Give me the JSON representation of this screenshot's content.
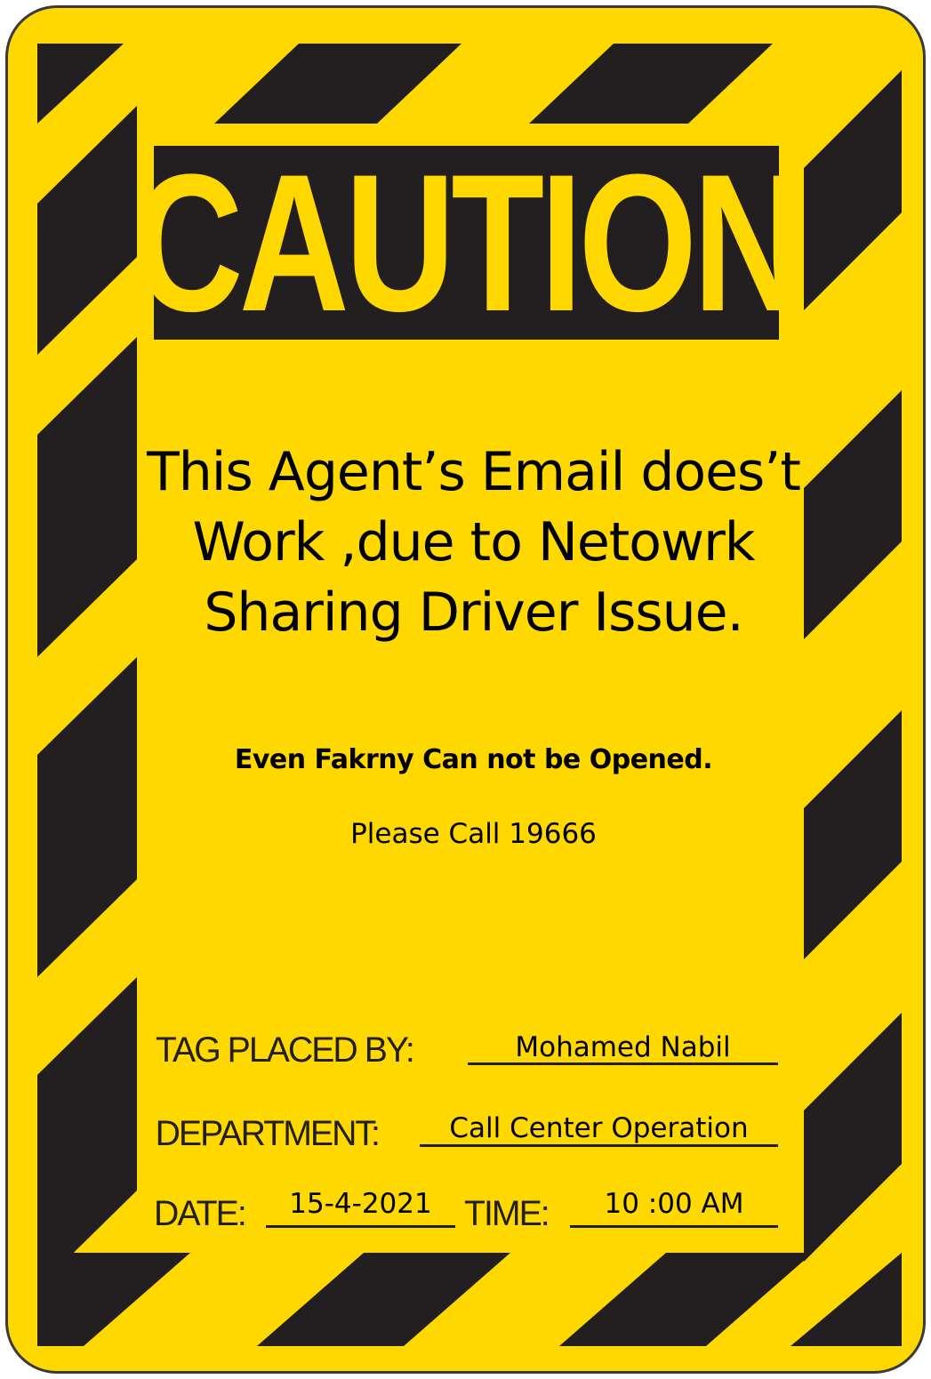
{
  "sign": {
    "heading": "CAUTION",
    "message": "This Agent’s Email does’t Work ,due to Netowrk Sharing Driver Issue.",
    "note": "Even Fakrny Can not be Opened.",
    "call": "Please Call 19666"
  },
  "fields": {
    "placed_by_label": "TAG PLACED BY:",
    "placed_by_value": "Mohamed Nabil",
    "department_label": "DEPARTMENT:",
    "department_value": "Call Center Operation",
    "date_label": "DATE:",
    "date_value": "15-4-2021",
    "time_label": "TIME:",
    "time_value": "10 :00 AM"
  },
  "colors": {
    "background": "#ffd800",
    "stripe": "#231f20",
    "text": "#000000"
  }
}
